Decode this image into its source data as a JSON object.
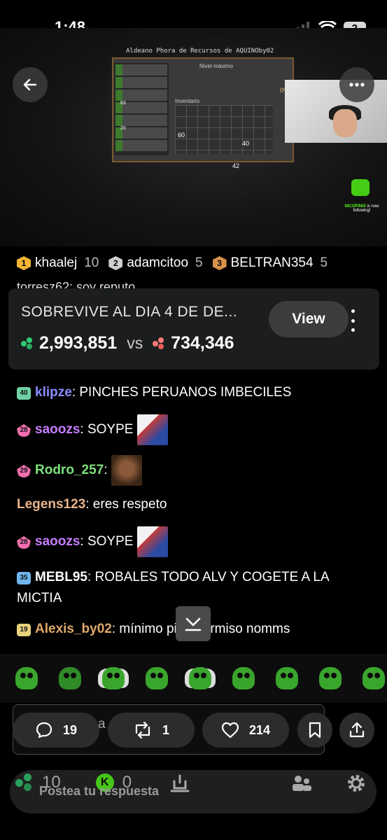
{
  "status": {
    "time": "1:48",
    "battery": "2"
  },
  "stream": {
    "game_title": "Aldeano Phora de Recursos de AQUINOby02",
    "game_level": "Nivel máximo",
    "game_percent": "0%",
    "game_inventory": "Inventario",
    "slot_counts": [
      "63",
      "20"
    ],
    "grid_counts": [
      "40",
      "60",
      "42"
    ],
    "follower_name": "NICOFINIS",
    "follower_text": "is now following!"
  },
  "leaderboard": [
    {
      "rank": "1",
      "name": "khaalej",
      "count": "10",
      "color": "#f2b634"
    },
    {
      "rank": "2",
      "name": "adamcitoo",
      "count": "5",
      "color": "#cfcfcf"
    },
    {
      "rank": "3",
      "name": "BELTRAN354",
      "count": "5",
      "color": "#d9914a"
    }
  ],
  "chat": {
    "cut_line": "torresz62: soy reputo",
    "messages": [
      {
        "level": "40",
        "user": "klipze",
        "text": "PINCHES PERUANOS IMBECILES",
        "user_color": "#8a8cff",
        "level_color": "#6fd2a3"
      },
      {
        "level": "28",
        "user": "saoozs",
        "text": "SOYPE",
        "user_color": "#c77dff",
        "level_color": "#f06fae"
      },
      {
        "level": "29",
        "user": "Rodro_257",
        "text": "",
        "user_color": "#7ee07a",
        "level_color": "#f06fae"
      },
      {
        "level": "",
        "user": "Legens123",
        "text": "eres respeto",
        "user_color": "#e8b48a",
        "level_color": ""
      },
      {
        "level": "28",
        "user": "saoozs",
        "text": "SOYPE",
        "user_color": "#c77dff",
        "level_color": "#f06fae"
      },
      {
        "level": "35",
        "user": "MEBL95",
        "text": "ROBALES TODO ALV Y COGETE A LA MICTIA",
        "user_color": "#ffffff",
        "level_color": "#6fb6f0"
      },
      {
        "level": "19",
        "user": "Alexis_by02",
        "text": "mínimo pide permiso nomms",
        "user_color": "#e0a868",
        "level_color": "#e6d27a"
      }
    ]
  },
  "prediction": {
    "title": "SOBREVIVE AL DIA 4 DE DE...",
    "view_label": "View",
    "green_total": "2,993,851",
    "vs_label": "vs",
    "red_total": "734,346"
  },
  "actions": {
    "input_hint": "a",
    "replies": "19",
    "reposts": "1",
    "likes": "214"
  },
  "reply": {
    "placeholder": "Postea tu respuesta",
    "kicks": "10",
    "k_count": "0"
  }
}
